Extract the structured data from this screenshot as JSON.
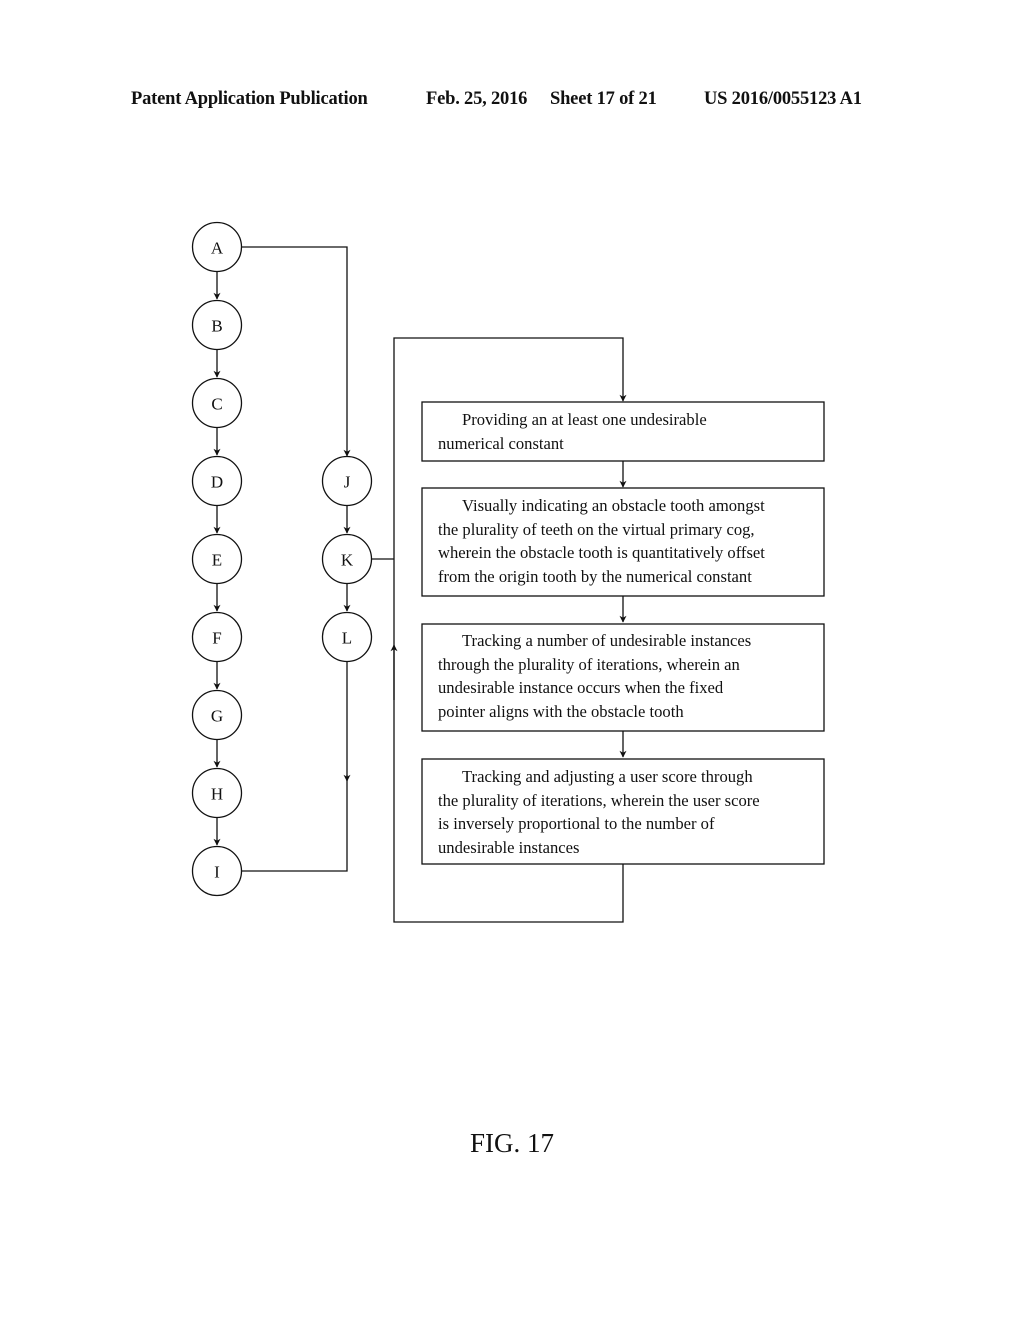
{
  "header": {
    "publication": "Patent Application Publication",
    "date": "Feb. 25, 2016",
    "sheet": "Sheet 17 of 21",
    "number": "US 2016/0055123 A1"
  },
  "connectors": [
    "A",
    "B",
    "C",
    "D",
    "E",
    "F",
    "G",
    "H",
    "I",
    "J",
    "K",
    "L"
  ],
  "boxes": [
    {
      "lines": [
        "Providing an at least one undesirable",
        "numerical constant"
      ]
    },
    {
      "lines": [
        "Visually indicating an obstacle tooth amongst",
        "the plurality of teeth on the virtual primary cog,",
        "wherein the obstacle tooth is quantitatively offset",
        "from the origin tooth by the numerical constant"
      ]
    },
    {
      "lines": [
        "Tracking a number of undesirable instances",
        "through the plurality of iterations, wherein an",
        "undesirable instance occurs when the fixed",
        "pointer aligns with the obstacle tooth"
      ]
    },
    {
      "lines": [
        "Tracking and adjusting a user score through",
        "the plurality of iterations, wherein the user score",
        "is inversely proportional to the number of",
        "undesirable instances"
      ]
    }
  ],
  "caption": "FIG. 17"
}
